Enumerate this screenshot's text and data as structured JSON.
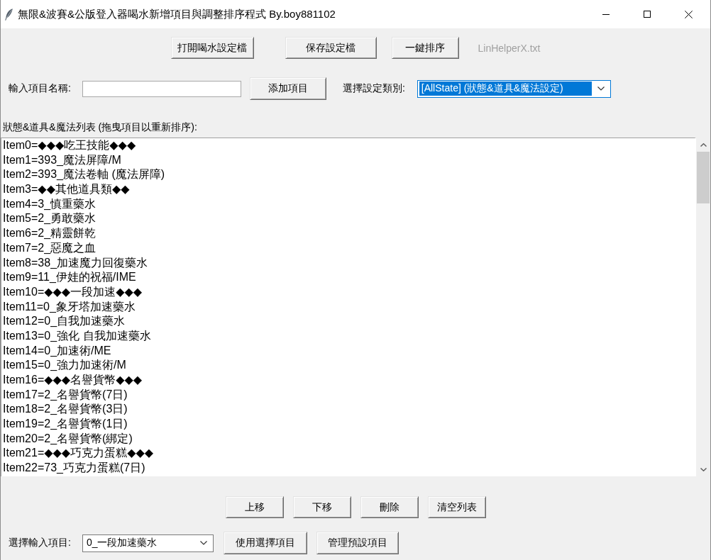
{
  "window": {
    "title": "無限&波賽&公版登入器喝水新增項目與調整排序程式 By.boy881102"
  },
  "toolbar": {
    "buttons": [
      "打開喝水設定檔",
      "保存設定檔",
      "一鍵排序"
    ],
    "file_label": "LinHelperX.txt"
  },
  "add_row": {
    "label": "輸入項目名稱:",
    "button": "添加項目",
    "category_label": "選擇設定類別:",
    "category": {
      "value": "[AllState] (狀態&道具&魔法設定)",
      "highlighted": true
    }
  },
  "list": {
    "label": "狀態&道具&魔法列表 (拖曳項目以重新排序):",
    "items": [
      {
        "text": "Item0=◆◆◆吃王技能◆◆◆",
        "selected": false
      },
      {
        "text": "Item1=393_魔法屏障/M",
        "selected": false
      },
      {
        "text": "Item2=393_魔法卷軸 (魔法屏障)",
        "selected": false
      },
      {
        "text": "Item3=◆◆其他道具類◆◆",
        "selected": false
      },
      {
        "text": "Item4=3_慎重藥水",
        "selected": false
      },
      {
        "text": "Item5=2_勇敢藥水",
        "selected": false
      },
      {
        "text": "Item6=2_精靈餅乾",
        "selected": false
      },
      {
        "text": "Item7=2_惡魔之血",
        "selected": false
      },
      {
        "text": "Item8=38_加速魔力回復藥水",
        "selected": false
      },
      {
        "text": "Item9=11_伊娃的祝福/IME",
        "selected": false
      },
      {
        "text": "Item10=◆◆◆一段加速◆◆◆",
        "selected": false
      },
      {
        "text": "Item11=0_象牙塔加速藥水",
        "selected": false
      },
      {
        "text": "Item12=0_自我加速藥水",
        "selected": false
      },
      {
        "text": "Item13=0_強化 自我加速藥水",
        "selected": false
      },
      {
        "text": "Item14=0_加速術/ME",
        "selected": false
      },
      {
        "text": "Item15=0_強力加速術/M",
        "selected": false
      },
      {
        "text": "Item16=◆◆◆名譽貨幣◆◆◆",
        "selected": false
      },
      {
        "text": "Item17=2_名譽貨幣(7日)",
        "selected": false
      },
      {
        "text": "Item18=2_名譽貨幣(3日)",
        "selected": false
      },
      {
        "text": "Item19=2_名譽貨幣(1日)",
        "selected": false
      },
      {
        "text": "Item20=2_名譽貨幣(綁定)",
        "selected": false
      },
      {
        "text": "Item21=◆◆◆巧克力蛋糕◆◆◆",
        "selected": false
      },
      {
        "text": "Item22=73_巧克力蛋糕(7日)",
        "selected": false
      }
    ]
  },
  "list_buttons": [
    "上移",
    "下移",
    "刪除",
    "清空列表"
  ],
  "bottom_row": {
    "label": "選擇輸入項目:",
    "preset": {
      "value": "0_一段加速藥水"
    },
    "buttons": [
      "使用選擇項目",
      "管理預設項目"
    ]
  }
}
